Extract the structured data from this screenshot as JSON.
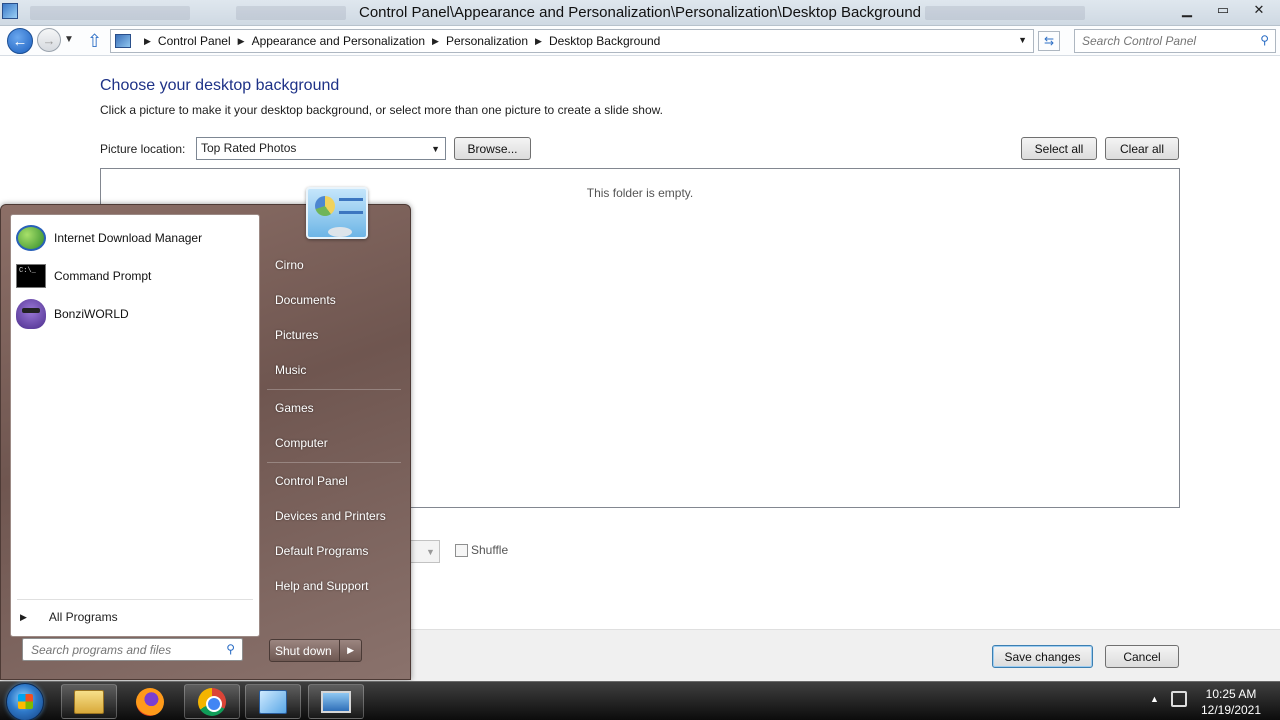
{
  "window": {
    "title": "Control Panel\\Appearance and Personalization\\Personalization\\Desktop Background",
    "minimize": "▁",
    "maximize": "▭",
    "close": "✕"
  },
  "address": {
    "breadcrumbs": [
      "Control Panel",
      "Appearance and Personalization",
      "Personalization",
      "Desktop Background"
    ],
    "search_placeholder": "Search Control Panel"
  },
  "content": {
    "heading": "Choose your desktop background",
    "description": "Click a picture to make it your desktop background, or select more than one picture to create a slide show.",
    "picture_location_label": "Picture location:",
    "picture_location_value": "Top Rated Photos",
    "browse_button": "Browse...",
    "select_all_button": "Select all",
    "clear_all_button": "Clear all",
    "empty_message": "This folder is empty.",
    "shuffle_label": "Shuffle",
    "save_button": "Save changes",
    "cancel_button": "Cancel"
  },
  "start_menu": {
    "pinned_programs": [
      "Internet Download Manager",
      "Command Prompt",
      "BonziWORLD"
    ],
    "all_programs": "All Programs",
    "search_placeholder": "Search programs and files",
    "right_items": [
      "Cirno",
      "Documents",
      "Pictures",
      "Music",
      "Games",
      "Computer",
      "Control Panel",
      "Devices and Printers",
      "Default Programs",
      "Help and Support"
    ],
    "shutdown_label": "Shut down"
  },
  "taskbar": {
    "time": "10:25 AM",
    "date": "12/19/2021",
    "icons": [
      "windows-explorer-icon",
      "firefox-icon",
      "chrome-icon",
      "control-panel-icon",
      "desktop-background-icon"
    ]
  },
  "colors": {
    "heading": "#1e3287",
    "start_menu": "#6f5650",
    "taskbar": "#0c0c0c"
  }
}
